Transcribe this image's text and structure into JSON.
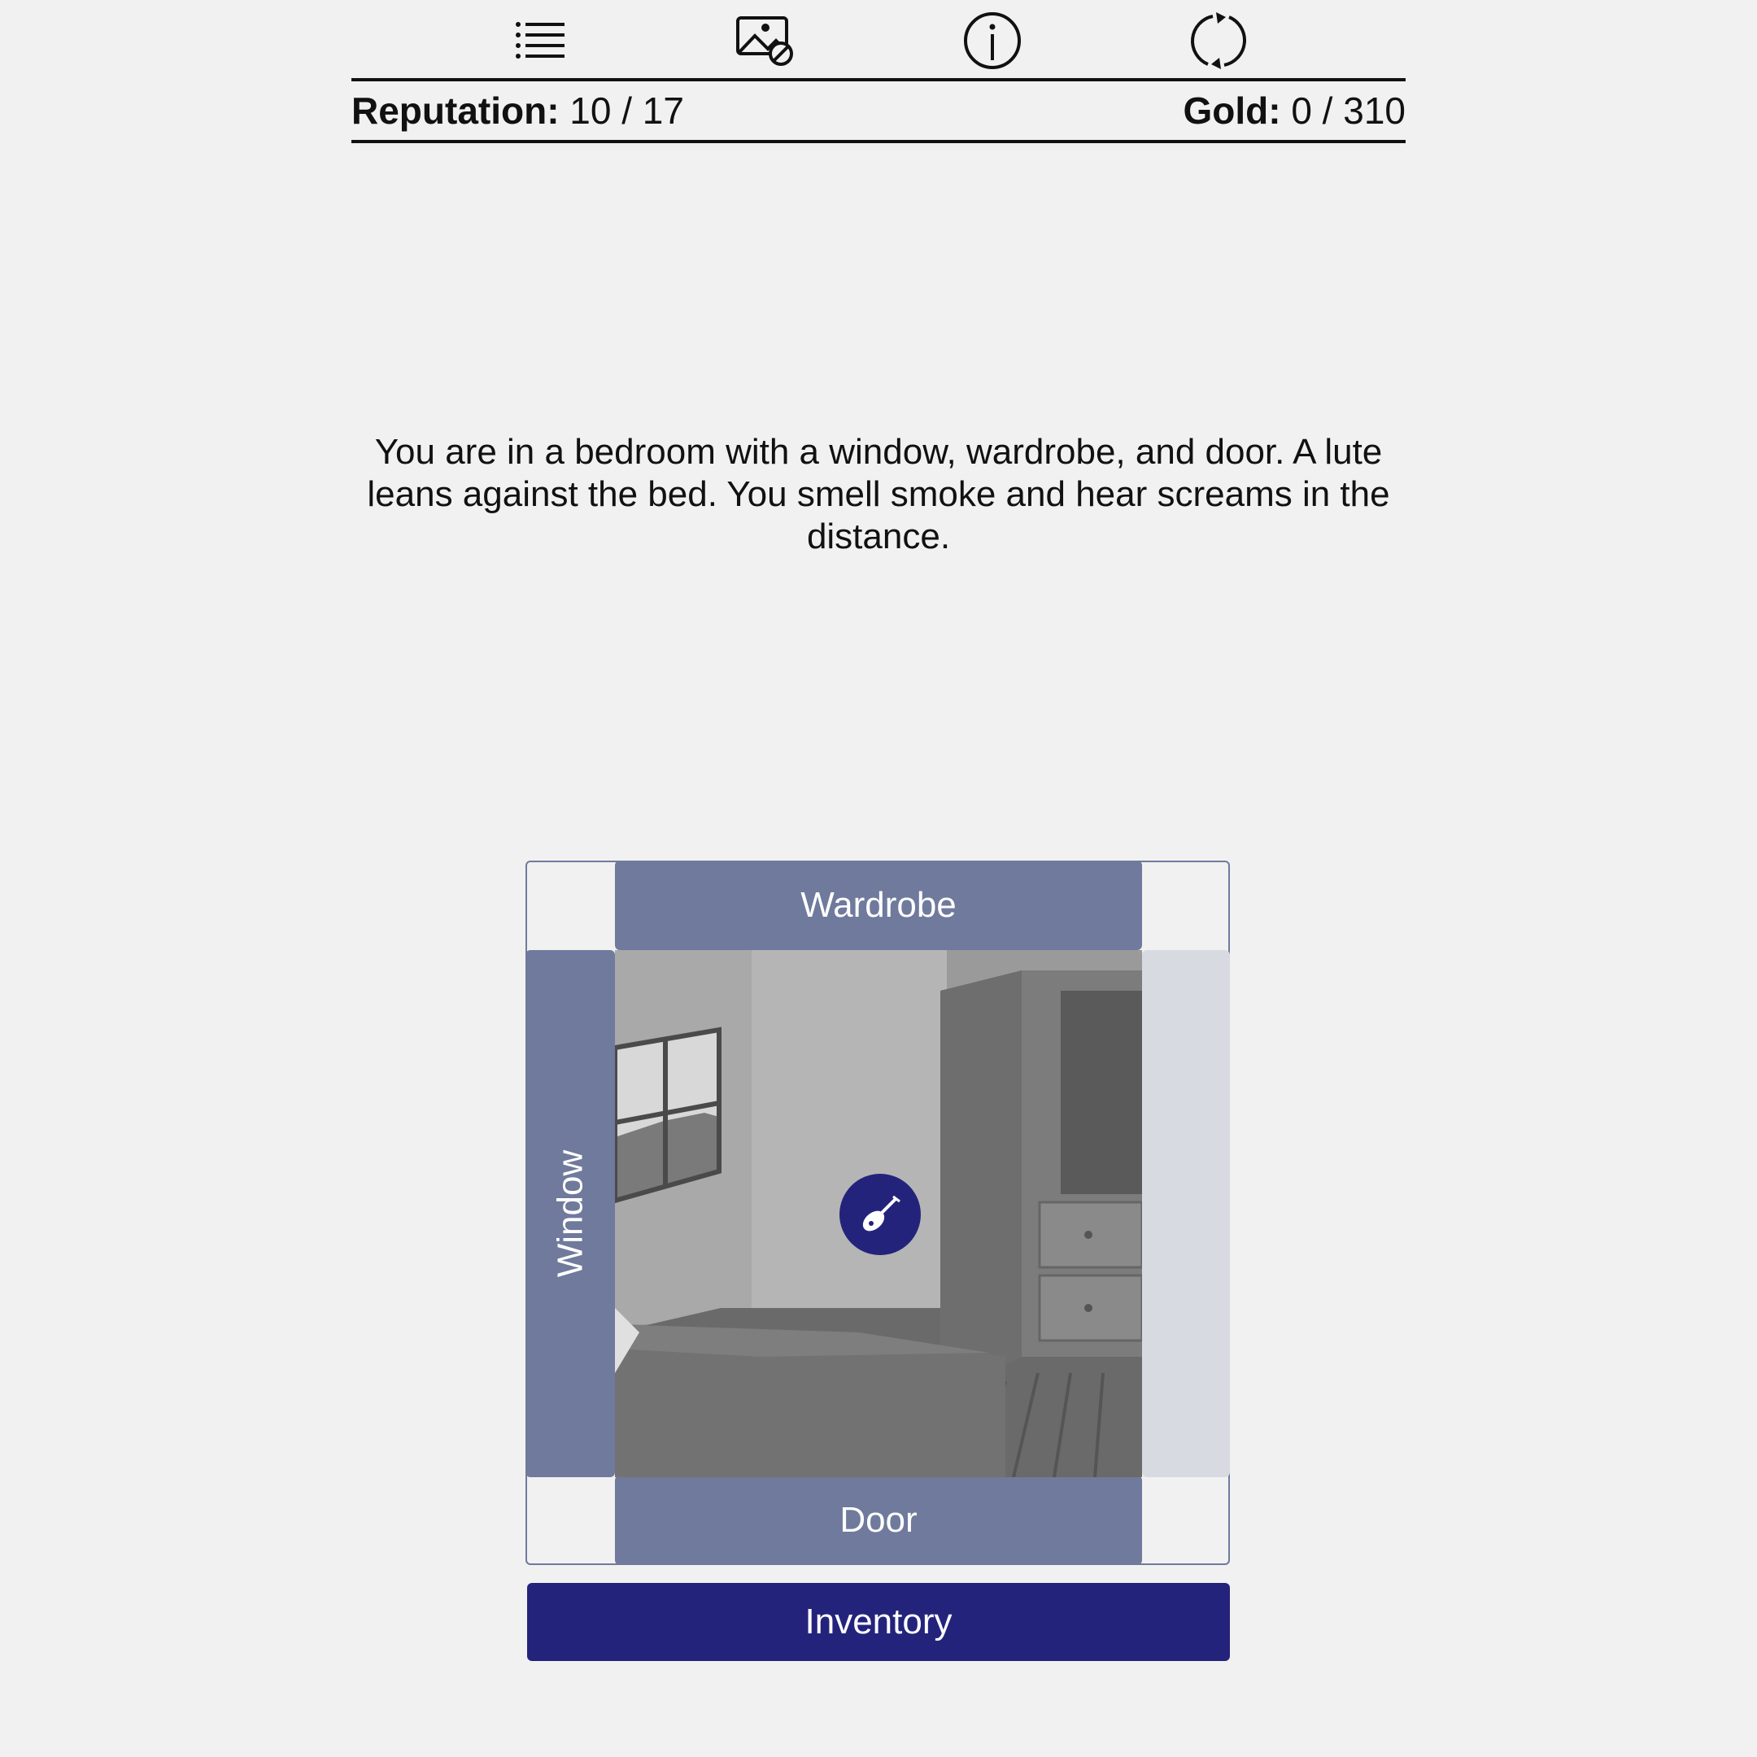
{
  "toolbar": {
    "icons": [
      "list-icon",
      "image-toggle-icon",
      "info-icon",
      "restart-icon"
    ]
  },
  "stats": {
    "reputation_label": "Reputation:",
    "reputation_value": "10 / 17",
    "gold_label": "Gold:",
    "gold_value": "0 / 310"
  },
  "description": "You are in a bedroom with a window, wardrobe, and door. A lute leans against the bed. You smell smoke and hear screams in the distance.",
  "room": {
    "exits": {
      "north": "Wardrobe",
      "west": "Window",
      "south": "Door"
    },
    "item_icon": "lute-icon"
  },
  "inventory_label": "Inventory",
  "colors": {
    "exit": "#6f7a9c",
    "exit_disabled": "#d8dae2",
    "primary": "#24237c",
    "background": "#f1f1f1"
  }
}
